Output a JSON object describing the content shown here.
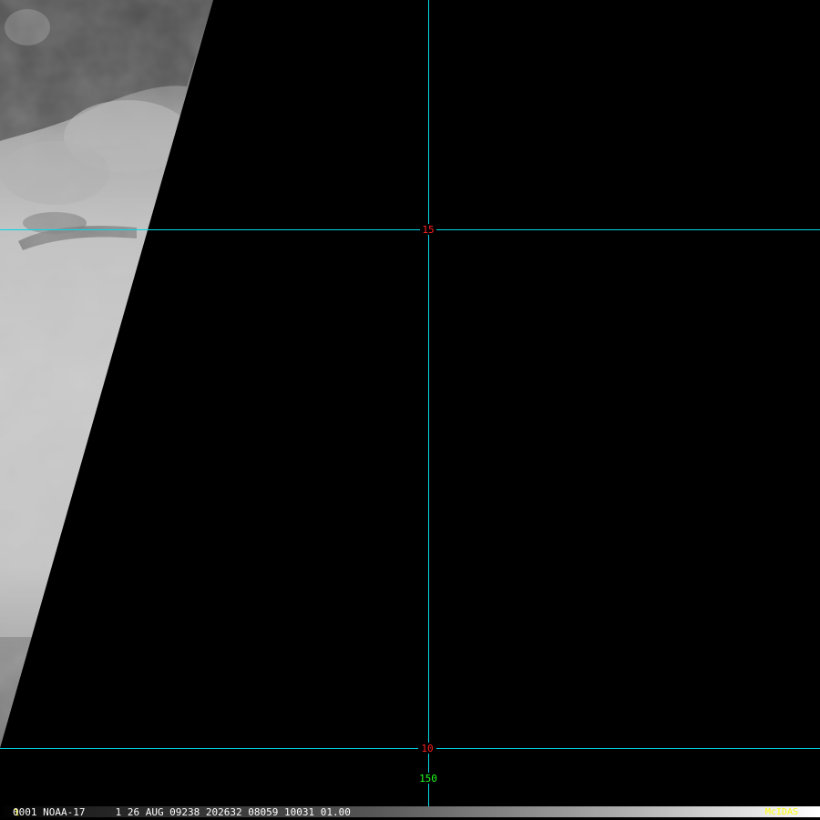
{
  "grid": {
    "lat_labels": [
      "15",
      "10"
    ],
    "lon_labels": [
      "150"
    ],
    "line_color": "#00d8e8",
    "lat_label_color": "#ff2020",
    "lon_label_color": "#20ff20"
  },
  "status": {
    "frame": "1",
    "info": "0001 NOAA-17     1 26 AUG 09238 202632 08059 10031 01.00",
    "brand": "McIDAS",
    "text_color": "#ffffff",
    "brand_color": "#ffff00"
  }
}
